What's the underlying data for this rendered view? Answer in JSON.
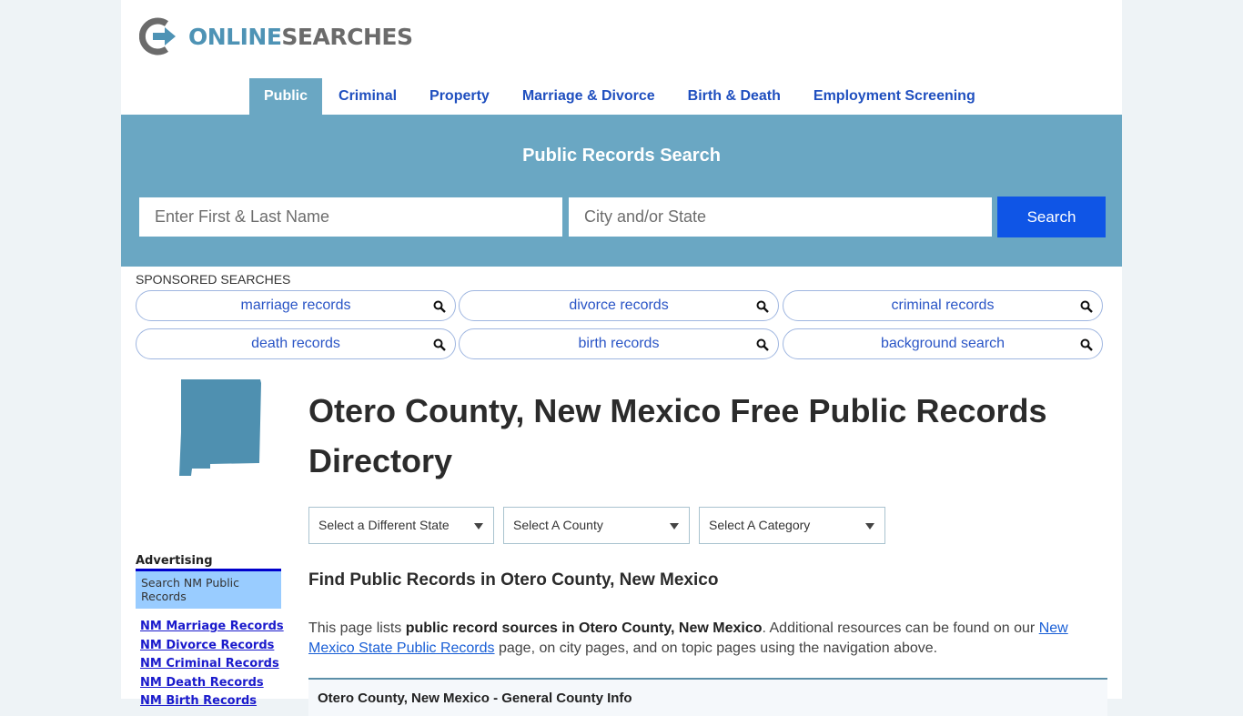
{
  "brand": {
    "logo_icon": "power-arrow-logo-icon",
    "name_part1": "ONLINE",
    "name_part2": "SEARCHES",
    "colors": {
      "primary": "#4e93b5",
      "secondary": "#6b6b6b"
    }
  },
  "nav": {
    "items": [
      {
        "label": "Public",
        "active": true
      },
      {
        "label": "Criminal",
        "active": false
      },
      {
        "label": "Property",
        "active": false
      },
      {
        "label": "Marriage & Divorce",
        "active": false
      },
      {
        "label": "Birth & Death",
        "active": false
      },
      {
        "label": "Employment Screening",
        "active": false
      }
    ]
  },
  "search": {
    "title": "Public Records Search",
    "name_placeholder": "Enter First & Last Name",
    "name_value": "",
    "location_placeholder": "City and/or State",
    "location_value": "",
    "button_label": "Search",
    "band_color": "#6aa7c3",
    "button_color": "#0f55e6"
  },
  "sponsored": {
    "label": "SPONSORED SEARCHES",
    "items": [
      {
        "label": "marriage records",
        "icon": "search-icon"
      },
      {
        "label": "divorce records",
        "icon": "search-icon"
      },
      {
        "label": "criminal records",
        "icon": "search-icon"
      },
      {
        "label": "death records",
        "icon": "search-icon"
      },
      {
        "label": "birth records",
        "icon": "search-icon"
      },
      {
        "label": "background search",
        "icon": "search-icon"
      }
    ]
  },
  "sidebar": {
    "state_image": "new-mexico-state-shape",
    "advertising_label": "Advertising",
    "ad_box_text": "Search NM Public Records",
    "links": [
      "NM Marriage Records",
      "NM Divorce Records",
      "NM Criminal Records",
      "NM Death Records",
      "NM Birth Records"
    ]
  },
  "main": {
    "title": "Otero County, New Mexico Free Public Records Directory",
    "selects": {
      "state": "Select a Different State",
      "county": "Select A County",
      "category": "Select A Category"
    },
    "subtitle": "Find Public Records in Otero County, New Mexico",
    "intro": {
      "before": "This page lists ",
      "bold": "public record sources in Otero County, New Mexico",
      "middle": ". Additional resources can be found on our ",
      "link": "New Mexico State Public Records",
      "after": " page, on city pages, and on topic pages using the navigation above."
    },
    "info_box_title": "Otero County, New Mexico - General County Info"
  }
}
